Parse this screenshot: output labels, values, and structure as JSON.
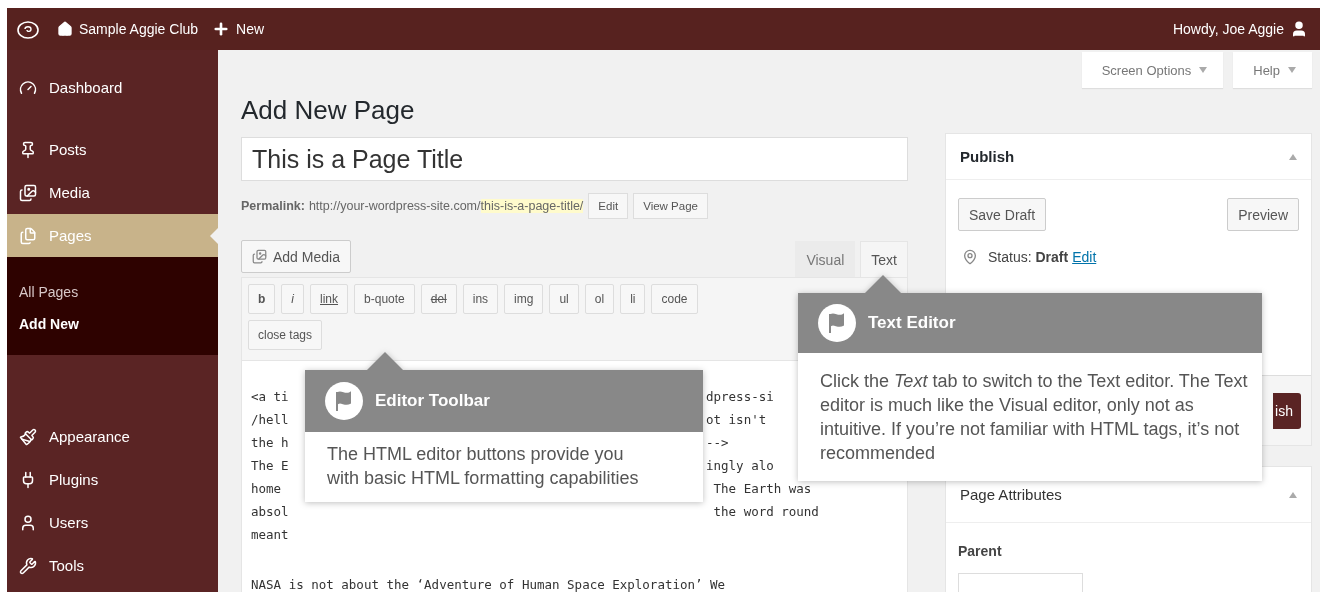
{
  "top_bar": {
    "site_name": "Sample Aggie Club",
    "new_label": "New",
    "greeting": "Howdy, Joe Aggie"
  },
  "sidebar": {
    "groups": [
      [
        {
          "label": "Dashboard",
          "kind": "dashboard",
          "selected": false
        }
      ],
      [
        {
          "label": "Posts",
          "kind": "posts",
          "selected": false
        },
        {
          "label": "Media",
          "kind": "media",
          "selected": false
        },
        {
          "label": "Pages",
          "kind": "pages",
          "selected": true,
          "children": [
            {
              "label": "All Pages",
              "selected": false
            },
            {
              "label": "Add New",
              "selected": true
            }
          ]
        }
      ],
      [
        {
          "label": "Appearance",
          "kind": "appearance",
          "selected": false
        },
        {
          "label": "Plugins",
          "kind": "plugins",
          "selected": false
        },
        {
          "label": "Users",
          "kind": "users",
          "selected": false
        },
        {
          "label": "Tools",
          "kind": "tools",
          "selected": false
        }
      ]
    ]
  },
  "screen_tabs": [
    {
      "label": "Screen Options"
    },
    {
      "label": "Help"
    }
  ],
  "heading": "Add New Page",
  "title_field": {
    "value": "This is a Page Title"
  },
  "permalink": {
    "label": "Permalink:",
    "base": "http://your-wordpress-site.com/",
    "slug": "this-is-a-page-title/",
    "buttons": [
      "Edit",
      "View Page"
    ]
  },
  "add_media": "Add Media",
  "editor_tabs": [
    {
      "label": "Visual",
      "selected": false
    },
    {
      "label": "Text",
      "selected": true
    }
  ],
  "quicktags": [
    [
      {
        "label": "b",
        "kind": "bold"
      },
      {
        "label": "i",
        "kind": "italic"
      },
      {
        "label": "link",
        "kind": "link"
      },
      {
        "label": "b-quote",
        "kind": "plain"
      },
      {
        "label": "del",
        "kind": "strike"
      },
      {
        "label": "ins",
        "kind": "plain"
      },
      {
        "label": "img",
        "kind": "plain"
      },
      {
        "label": "ul",
        "kind": "plain"
      },
      {
        "label": "ol",
        "kind": "plain"
      },
      {
        "label": "li",
        "kind": "plain"
      },
      {
        "label": "code",
        "kind": "plain"
      }
    ],
    [
      {
        "label": "close tags",
        "kind": "plain"
      }
    ]
  ],
  "editor_lines": [
    {
      "left": "<a ti",
      "right": "dpress-si"
    },
    {
      "left": "/hell",
      "right": "ot isn't"
    },
    {
      "left": "the h",
      "right": "-->"
    },
    {
      "left": "The E",
      "right": "ingly alo"
    },
    {
      "left": "home",
      "right": " The Earth was"
    },
    {
      "left": "absol",
      "right": " the word round"
    },
    {
      "left": "meant"
    }
  ],
  "editor_paragraph": "NASA is not about the ‘Adventure of Human Space Exploration’ We",
  "publish": {
    "title": "Publish",
    "buttons": [
      "Save Draft",
      "Preview"
    ],
    "status": "Status: **Draft**",
    "status_link": "Edit",
    "publish_button": "ish"
  },
  "page_attributes": {
    "title": "Page Attributes",
    "parent_label": "Parent"
  },
  "tooltips": [
    {
      "title": "Editor Toolbar",
      "text": "The HTML editor buttons provide you with basic HTML formatting capabilities"
    },
    {
      "title": "Text Editor",
      "text": "Click the *Text* tab to switch to the Text editor. The Text editor is much like the Visual editor, only not as intuitive. If you’re not familiar with HTML tags, it’s not recommended"
    }
  ]
}
